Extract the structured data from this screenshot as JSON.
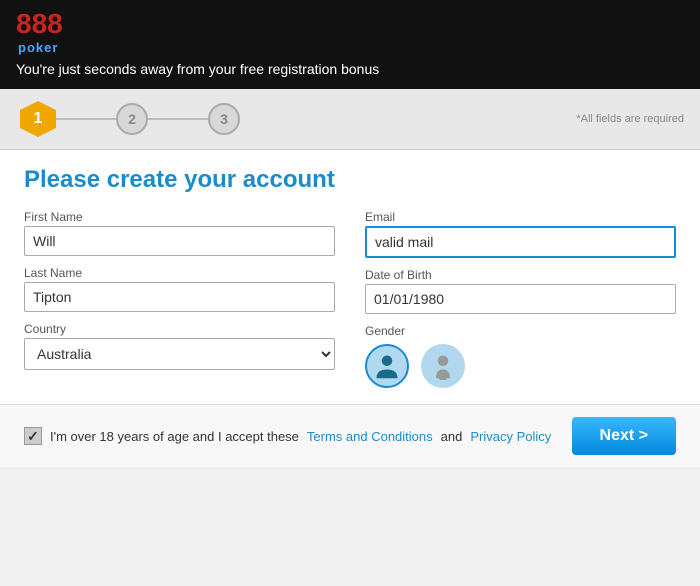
{
  "header": {
    "logo_888": "888",
    "logo_poker": "poker",
    "tagline": "You're just seconds away from your free registration bonus"
  },
  "steps": {
    "step1_label": "1",
    "step2_label": "2",
    "step3_label": "3",
    "required_note": "*All fields are required"
  },
  "form": {
    "title": "Please create your account",
    "first_name_label": "First Name",
    "first_name_value": "Will",
    "last_name_label": "Last Name",
    "last_name_value": "Tipton",
    "country_label": "Country",
    "country_value": "Australia",
    "email_label": "Email",
    "email_value": "valid mail",
    "dob_label": "Date of Birth",
    "dob_value": "01/01/1980",
    "gender_label": "Gender"
  },
  "footer": {
    "terms_text_before": "I'm over 18 years of age and I accept these ",
    "terms_link": "Terms and Conditions",
    "terms_text_between": " and ",
    "privacy_link": "Privacy Policy",
    "next_button": "Next >"
  }
}
